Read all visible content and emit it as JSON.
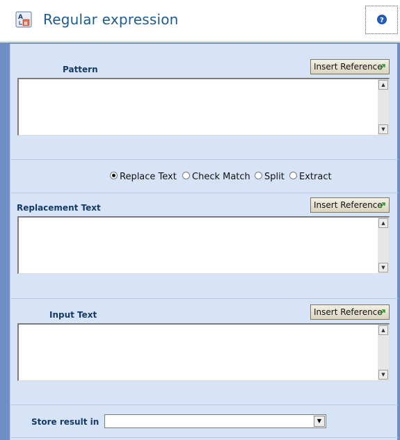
{
  "header": {
    "title": "Regular expression",
    "app_icon": "regex-app-icon",
    "help_icon": "help-icon"
  },
  "pattern": {
    "label": "Pattern",
    "value": "",
    "insert_label": "Insert Reference"
  },
  "options": {
    "selected": "Replace Text",
    "items": [
      "Replace Text",
      "Check Match",
      "Split",
      "Extract"
    ]
  },
  "replacement": {
    "label": "Replacement Text",
    "value": "",
    "insert_label": "Insert Reference"
  },
  "input": {
    "label": "Input Text",
    "value": "",
    "insert_label": "Insert Reference"
  },
  "store": {
    "label": "Store result in",
    "value": ""
  },
  "colors": {
    "title": "#1d5a8f",
    "panel_bg": "#d7e4f7",
    "label": "#153a66",
    "side_bar": "#6d8fc4"
  }
}
